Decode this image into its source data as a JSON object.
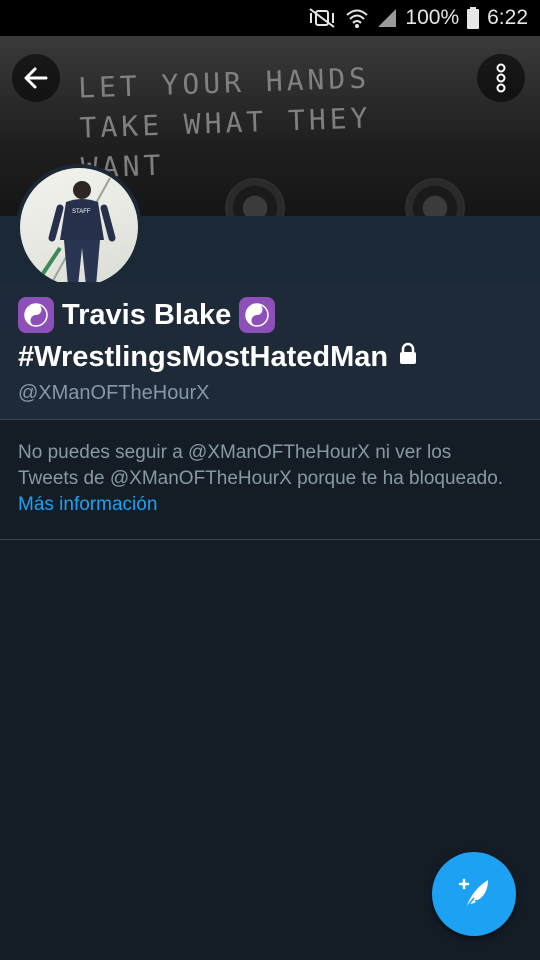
{
  "status_bar": {
    "battery": "100%",
    "time": "6:22",
    "icons": [
      "mute-vibrate-icon",
      "wifi-icon",
      "signal-icon",
      "battery-icon"
    ]
  },
  "banner": {
    "graffiti_text": "LET YOUR HANDS TAKE WHAT THEY WANT"
  },
  "profile": {
    "emoji_left": "☯️",
    "name": "Travis Blake",
    "emoji_right": "☯️",
    "name_line2": "#WrestlingsMostHatedMan",
    "handle": "@XManOFTheHourX",
    "protected_icon": "lock-icon"
  },
  "blocked_notice": {
    "text": "No puedes seguir a @XManOFTheHourX ni ver los Tweets de @XManOFTheHourX porque te ha bloqueado.",
    "link": "Más información"
  },
  "colors": {
    "background": "#141d26",
    "info_panel": "#1e2a38",
    "accent": "#1da1f2",
    "muted_text": "#8899a6",
    "yin_yang_badge": "#8d4fb8"
  }
}
